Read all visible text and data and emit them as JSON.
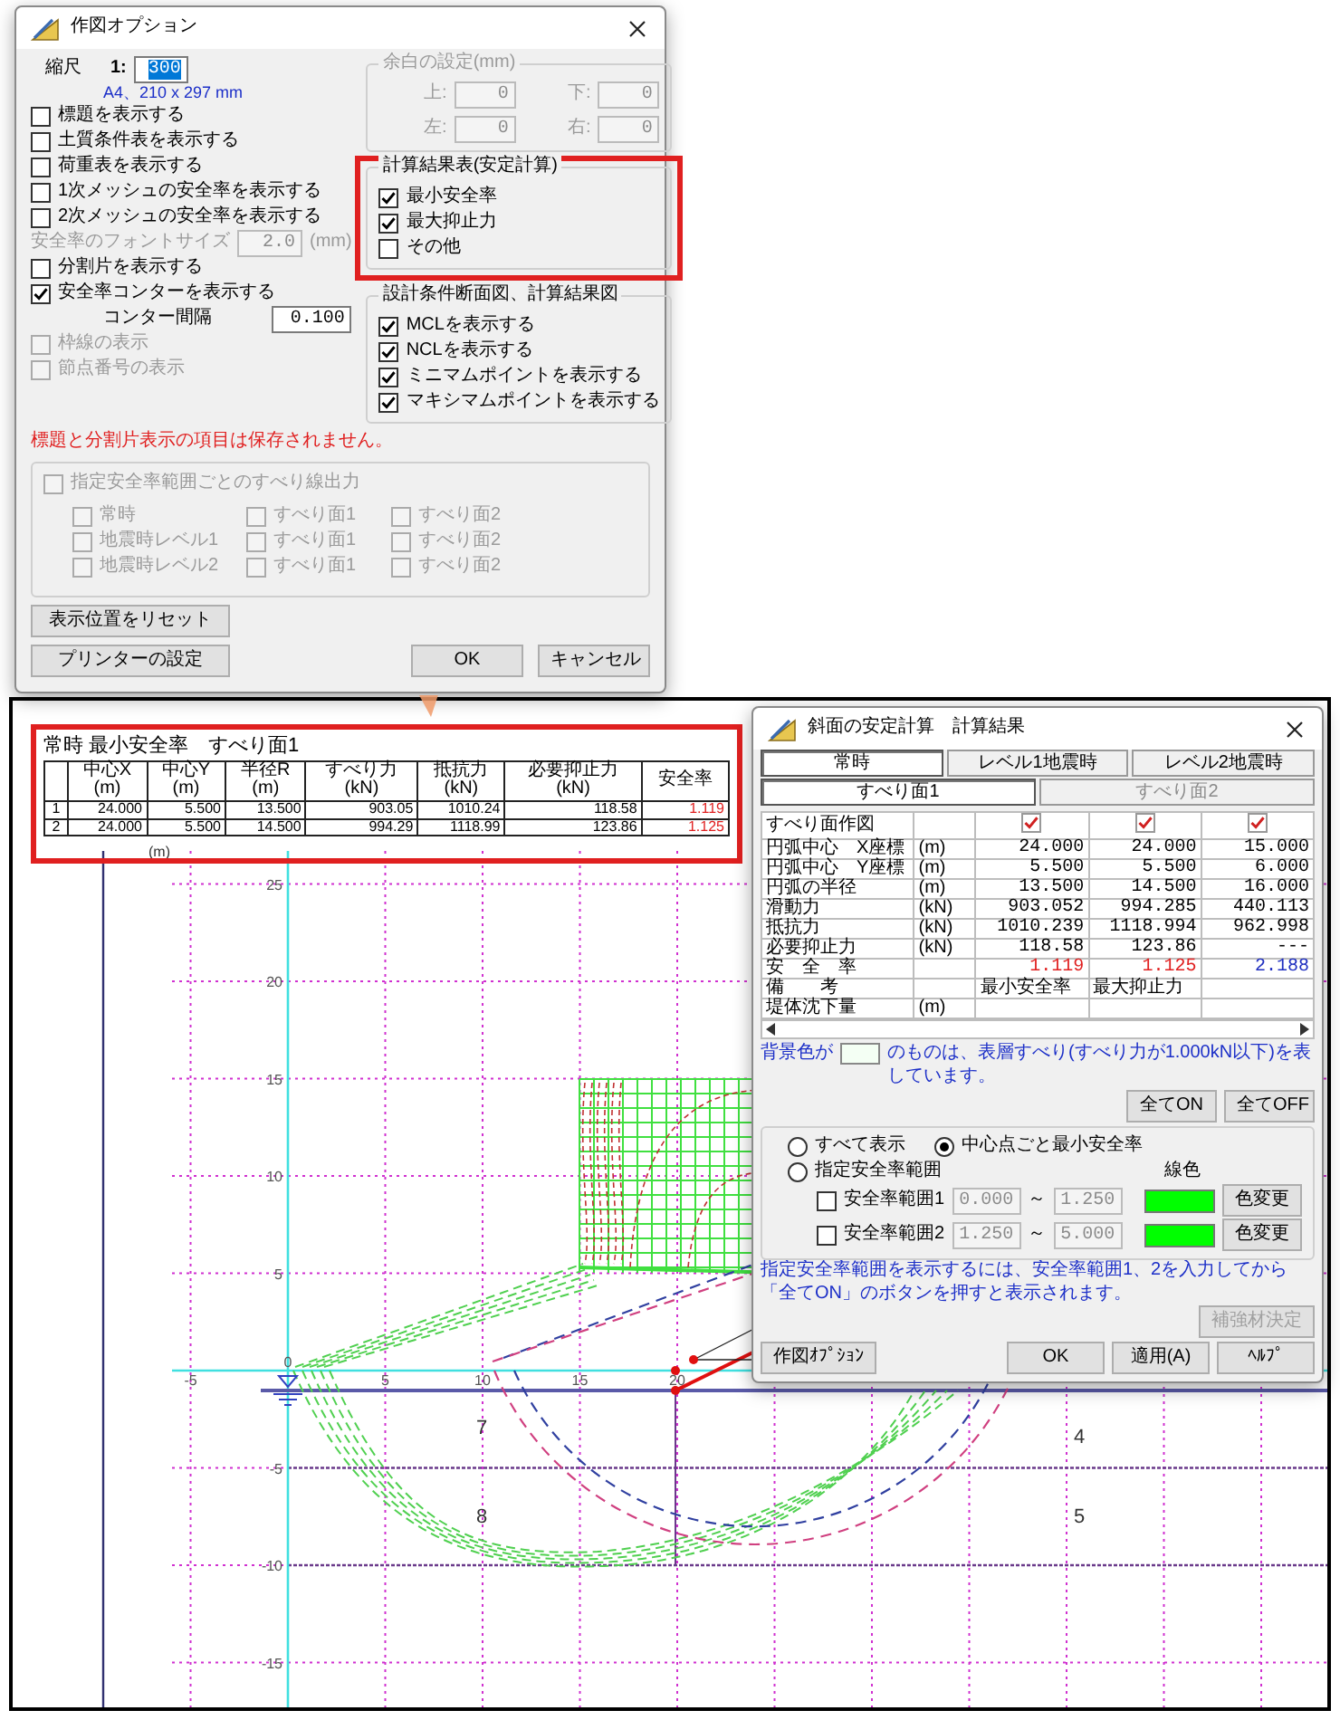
{
  "options_dialog": {
    "title": "作図オプション",
    "scale": {
      "label": "縮尺",
      "prefix": "1:",
      "value": "300",
      "value_selected": true
    },
    "paper_note": "A4、210 x 297 mm",
    "items": [
      {
        "kind": "checkbox",
        "label": "標題を表示する",
        "checked": false,
        "disabled": false
      },
      {
        "kind": "checkbox",
        "label": "土質条件表を表示する",
        "checked": false,
        "disabled": false
      },
      {
        "kind": "checkbox",
        "label": "荷重表を表示する",
        "checked": false,
        "disabled": false
      },
      {
        "kind": "checkbox",
        "label": "1次メッシュの安全率を表示する",
        "checked": false,
        "disabled": false
      },
      {
        "kind": "checkbox",
        "label": "2次メッシュの安全率を表示する",
        "checked": false,
        "disabled": false
      },
      {
        "kind": "field",
        "label": "安全率のフォントサイズ",
        "value": "2.0",
        "unit": "(mm)",
        "disabled": true
      },
      {
        "kind": "checkbox",
        "label": "分割片を表示する",
        "checked": false,
        "disabled": false
      },
      {
        "kind": "checkbox",
        "label": "安全率コンターを表示する",
        "checked": true,
        "disabled": false
      },
      {
        "kind": "field",
        "label": "コンター間隔",
        "value": "0.100",
        "disabled": false
      },
      {
        "kind": "checkbox",
        "label": "枠線の表示",
        "checked": false,
        "disabled": true
      },
      {
        "kind": "checkbox",
        "label": "節点番号の表示",
        "checked": false,
        "disabled": true
      }
    ],
    "margin_group": {
      "title": "余白の設定(mm)",
      "disabled": true,
      "fields": [
        {
          "label": "上:",
          "value": "0"
        },
        {
          "label": "下:",
          "value": "0"
        },
        {
          "label": "左:",
          "value": "0"
        },
        {
          "label": "右:",
          "value": "0"
        }
      ]
    },
    "result_group": {
      "title": "計算結果表(安定計算)",
      "highlighted": true,
      "items": [
        {
          "label": "最小安全率",
          "checked": true
        },
        {
          "label": "最大抑止力",
          "checked": true
        },
        {
          "label": "その他",
          "checked": false
        }
      ]
    },
    "figure_group": {
      "title": "設計条件断面図、計算結果図",
      "items": [
        {
          "label": "MCLを表示する",
          "checked": true
        },
        {
          "label": "NCLを表示する",
          "checked": true
        },
        {
          "label": "ミニマムポイントを表示する",
          "checked": true
        },
        {
          "label": "マキシマムポイントを表示する",
          "checked": true
        }
      ]
    },
    "warning": "標題と分割片表示の項目は保存されません。",
    "output_group": {
      "disabled": true,
      "label": "指定安全率範囲ごとのすべり線出力",
      "checked": false,
      "rows": [
        [
          {
            "label": "常時",
            "checked": false
          },
          {
            "label": "すべり面1",
            "checked": false
          },
          {
            "label": "すべり面2",
            "checked": false
          }
        ],
        [
          {
            "label": "地震時レベル1",
            "checked": false
          },
          {
            "label": "すべり面1",
            "checked": false
          },
          {
            "label": "すべり面2",
            "checked": false
          }
        ],
        [
          {
            "label": "地震時レベル2",
            "checked": false
          },
          {
            "label": "すべり面1",
            "checked": false
          },
          {
            "label": "すべり面2",
            "checked": false
          }
        ]
      ]
    },
    "side_buttons": [
      "表示位置をリセット",
      "プリンターの設定"
    ],
    "footer_buttons": [
      "OK",
      "キャンセル"
    ]
  },
  "drawing": {
    "unit_label": "(m)",
    "x_labels": [
      "-5",
      "0",
      "5",
      "10",
      "15",
      "20"
    ],
    "y_labels": [
      "25",
      "20",
      "15",
      "10",
      "5",
      "-5",
      "-10",
      "-15"
    ],
    "region_labels": [
      "7",
      "8",
      "4",
      "5"
    ]
  },
  "summary_table": {
    "highlighted": true,
    "title": "常時 最小安全率　すべり面1",
    "columns": [
      {
        "name": "中心X",
        "unit": "(m)"
      },
      {
        "name": "中心Y",
        "unit": "(m)"
      },
      {
        "name": "半径R",
        "unit": "(m)"
      },
      {
        "name": "すべり力",
        "unit": "(kN)"
      },
      {
        "name": "抵抗力",
        "unit": "(kN)"
      },
      {
        "name": "必要抑止力",
        "unit": "(kN)"
      },
      {
        "name": "安全率"
      }
    ],
    "rows": [
      {
        "no": "1",
        "cells": [
          "24.000",
          "5.500",
          "13.500",
          "903.05",
          "1010.24",
          "118.58"
        ],
        "safety": {
          "text": "1.119",
          "color": "#e02020"
        }
      },
      {
        "no": "2",
        "cells": [
          "24.000",
          "5.500",
          "14.500",
          "994.29",
          "1118.99",
          "123.86"
        ],
        "safety": {
          "text": "1.125",
          "color": "#e02020"
        }
      }
    ]
  },
  "result_dialog": {
    "title": "斜面の安定計算　計算結果",
    "case_tabs": [
      {
        "label": "常時",
        "selected": true
      },
      {
        "label": "レベル1地震時",
        "selected": false
      },
      {
        "label": "レベル2地震時",
        "selected": false
      }
    ],
    "surface_tabs": [
      {
        "label": "すべり面1",
        "selected": true
      },
      {
        "label": "すべり面2",
        "selected": false
      }
    ],
    "rows": [
      {
        "kind": "checks",
        "label": "すべり面作図",
        "checks": [
          {
            "checked": true
          },
          {
            "checked": true
          },
          {
            "checked": true
          }
        ]
      },
      {
        "kind": "values",
        "label": "円弧中心　X座標",
        "unit": "(m)",
        "values": [
          "24.000",
          "24.000",
          "15.000"
        ]
      },
      {
        "kind": "values",
        "label": "円弧中心　Y座標",
        "unit": "(m)",
        "values": [
          "5.500",
          "5.500",
          "6.000"
        ]
      },
      {
        "kind": "values",
        "label": "円弧の半径",
        "unit": "(m)",
        "values": [
          "13.500",
          "14.500",
          "16.000"
        ]
      },
      {
        "kind": "values",
        "label": "滑動力",
        "unit": "(kN)",
        "values": [
          "903.052",
          "994.285",
          "440.113"
        ]
      },
      {
        "kind": "values",
        "label": "抵抗力",
        "unit": "(kN)",
        "values": [
          "1010.239",
          "1118.994",
          "962.998"
        ]
      },
      {
        "kind": "values",
        "label": "必要抑止力",
        "unit": "(kN)",
        "values": [
          "118.58",
          "123.86",
          "---"
        ]
      },
      {
        "kind": "colored",
        "label": "安　全　率",
        "values": [
          {
            "text": "1.119",
            "color": "#e02020"
          },
          {
            "text": "1.125",
            "color": "#e02020"
          },
          {
            "text": "2.188",
            "color": "#2030c0"
          }
        ]
      },
      {
        "kind": "notes",
        "label": "備　　考",
        "values": [
          "最小安全率",
          "最大抑止力"
        ]
      },
      {
        "kind": "empty",
        "label": "堤体沈下量",
        "unit": "(m)"
      }
    ],
    "legend_note": {
      "before": "背景色が",
      "after": "のものは、表層すべり(すべり力が1.000kN以下)を表しています。"
    },
    "toggle_buttons": [
      "全てON",
      "全てOFF"
    ],
    "radios": [
      {
        "label": "すべて表示",
        "selected": false
      },
      {
        "label": "中心点ごと最小安全率",
        "selected": true
      },
      {
        "label": "指定安全率範囲",
        "selected": false
      }
    ],
    "line_color_label": "線色",
    "ranges": [
      {
        "label": "安全率範囲1",
        "checked": false,
        "from": "0.000",
        "separator": "～",
        "to": "1.250",
        "color": "#00ff00",
        "button": "色変更"
      },
      {
        "label": "安全率範囲2",
        "checked": false,
        "from": "1.250",
        "separator": "～",
        "to": "5.000",
        "color": "#00ff00",
        "button": "色変更"
      }
    ],
    "hint_lines": [
      "指定安全率範囲を表示するには、安全率範囲1、2を入力してから",
      "「全てON」のボタンを押すと表示されます。"
    ],
    "reinforce_button": {
      "label": "補強材決定",
      "disabled": true
    },
    "option_button": "作図ｵﾌﾟｼｮﾝ",
    "footer_buttons": [
      "OK",
      "適用(A)",
      "ﾍﾙﾌﾟ"
    ]
  }
}
